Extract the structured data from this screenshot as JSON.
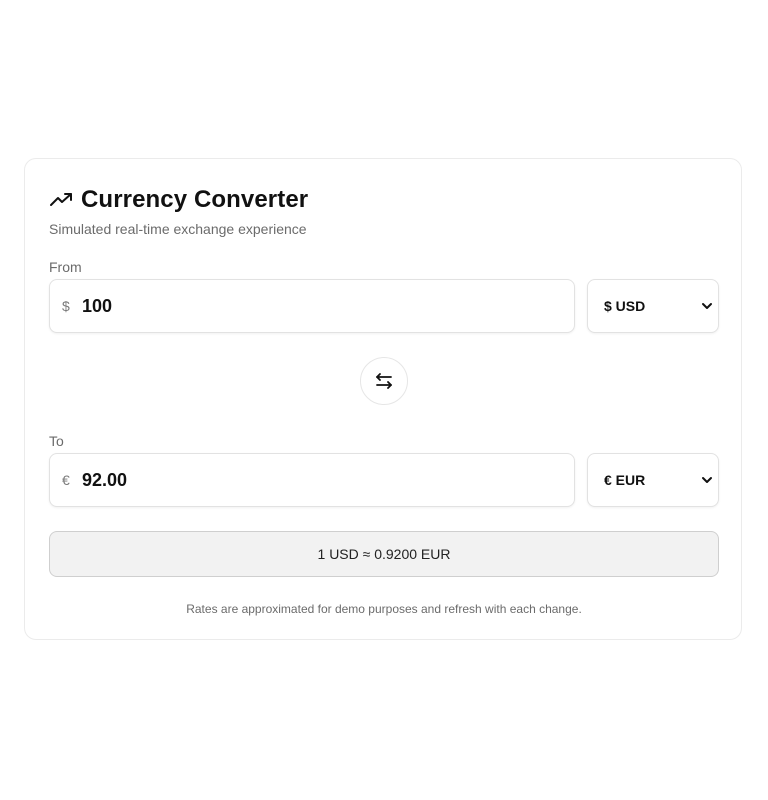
{
  "header": {
    "icon": "trending-up-icon",
    "title": "Currency Converter",
    "subtitle": "Simulated real-time exchange experience"
  },
  "from": {
    "label": "From",
    "symbol": "$",
    "amount": "100",
    "currency": "$ USD"
  },
  "swap": {
    "icon": "swap-arrows-icon"
  },
  "to": {
    "label": "To",
    "symbol": "€",
    "amount": "92.00",
    "currency": "€ EUR"
  },
  "rate": {
    "text": "1 USD ≈ 0.9200 EUR"
  },
  "footnote": "Rates are approximated for demo purposes and refresh with each change.",
  "colors": {
    "text": "#111111",
    "muted": "#6b6b6b",
    "border": "#e2e2e2",
    "rate_bg": "#f2f2f2"
  }
}
